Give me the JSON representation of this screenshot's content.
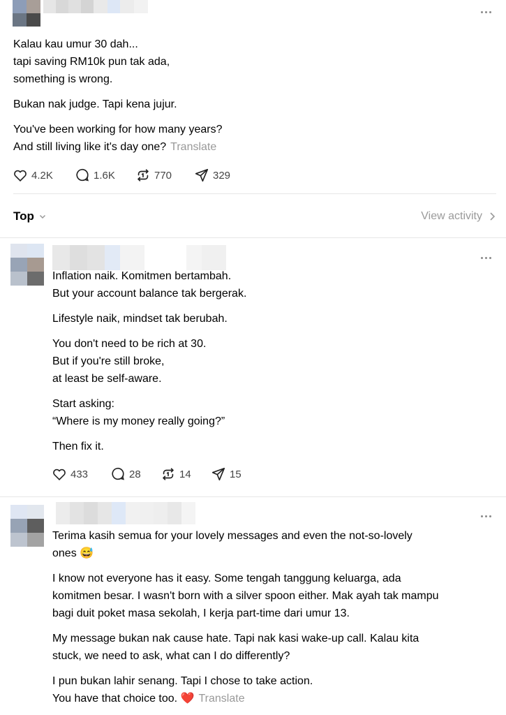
{
  "main_post": {
    "lines_1": [
      "Kalau kau umur 30 dah...",
      "tapi saving RM10k pun tak ada,",
      "something is wrong."
    ],
    "lines_2": [
      "Bukan nak judge. Tapi kena jujur."
    ],
    "lines_3": [
      "You've been working for how many years?",
      "And still living like it's day one?"
    ],
    "translate": "Translate",
    "stats": {
      "likes": "4.2K",
      "replies": "1.6K",
      "reposts": "770",
      "shares": "329"
    }
  },
  "filter": {
    "label": "Top",
    "view_activity": "View activity"
  },
  "reply_1": {
    "paragraphs": [
      [
        "Inflation naik. Komitmen bertambah.",
        "But your account balance tak bergerak."
      ],
      [
        "Lifestyle naik, mindset tak berubah."
      ],
      [
        "You don't need to be rich at 30.",
        "But if you're still broke,",
        "at least be self-aware."
      ],
      [
        "Start asking:",
        "“Where is my money really going?”"
      ],
      [
        "Then fix it."
      ]
    ],
    "stats": {
      "likes": "433",
      "replies": "28",
      "reposts": "14",
      "shares": "15"
    }
  },
  "reply_2": {
    "p1_line1": "Terima kasih semua for your lovely messages and even the not-so-lovely",
    "p1_line2": "ones",
    "emoji_grin": "😅",
    "p2": [
      "I know not everyone has it easy. Some tengah tanggung keluarga, ada",
      "komitmen besar. I wasn't born with a silver spoon either. Mak ayah tak mampu",
      "bagi duit poket masa sekolah, I kerja part-time dari umur 13."
    ],
    "p3": [
      "My message bukan nak cause hate. Tapi nak kasi wake-up call. Kalau kita",
      "stuck, we need to ask, what can I do differently?"
    ],
    "p4_line1": "I pun bukan lahir senang. Tapi I chose to take action.",
    "p4_line2": "You have that choice too.",
    "emoji_heart": "❤️",
    "translate": "Translate"
  },
  "colors": {
    "muted": "#999999",
    "divider": "#e6e6e6",
    "text": "#000000",
    "pixelation": [
      "#8d9db8",
      "#a89e98",
      "#5a5a5a",
      "#d9d9d9",
      "#dfe8f5"
    ]
  },
  "icons": [
    "more-icon",
    "heart-icon",
    "reply-icon",
    "repost-icon",
    "share-icon",
    "chevron-down-icon",
    "chevron-right-icon"
  ]
}
